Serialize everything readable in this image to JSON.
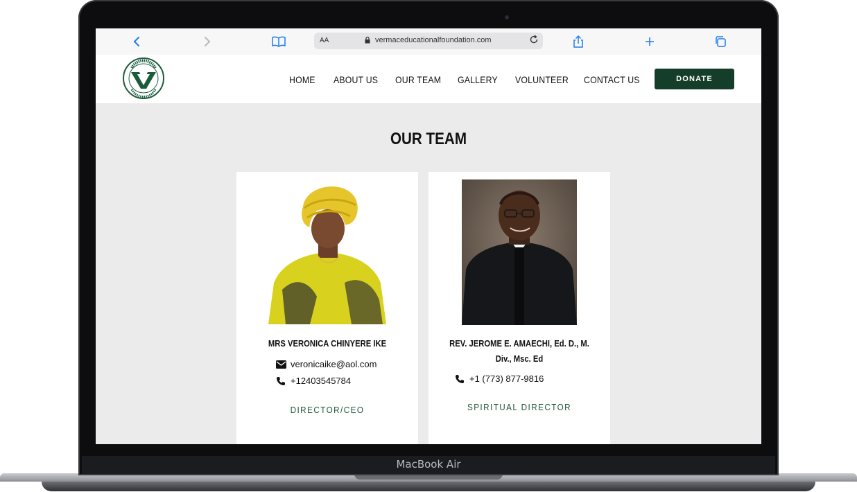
{
  "device": {
    "label": "MacBook Air"
  },
  "browser": {
    "url": "vermaceducationalfoundation.com",
    "text_size_label": "AA",
    "icons": [
      "back-icon",
      "forward-icon",
      "bookmarks-icon",
      "lock-icon",
      "reload-icon",
      "share-icon",
      "new-tab-icon",
      "tabs-icon"
    ],
    "accent": "#1d7cf2"
  },
  "site": {
    "nav": [
      "HOME",
      "ABOUT US",
      "OUR TEAM",
      "GALLERY",
      "VOLUNTEER",
      "CONTACT US"
    ],
    "donate_label": "DONATE",
    "brand_color": "#153e2a",
    "logo_text": "VERMAC EDUCATIONAL FOUNDATION"
  },
  "main": {
    "title": "OUR TEAM",
    "members": [
      {
        "name": "MRS VERONICA CHINYERE IKE",
        "email": "veronicaike@aol.com",
        "phone": "+12403545784",
        "role": "DIRECTOR/CEO"
      },
      {
        "name": "REV. JEROME E. AMAECHI, Ed. D., M. Div., Msc. Ed",
        "phone": "+1 (773) 877-9816",
        "role": "SPIRITUAL DIRECTOR"
      }
    ]
  }
}
